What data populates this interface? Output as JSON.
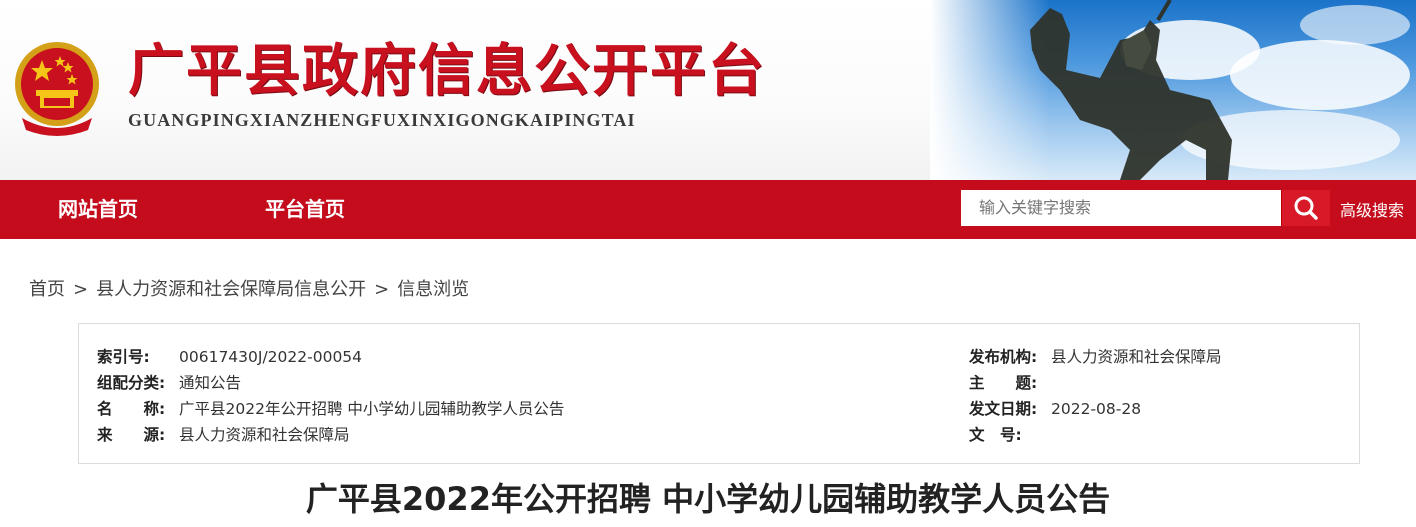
{
  "header": {
    "title": "广平县政府信息公开平台",
    "subtitle": "GUANGPINGXIANZHENGFUXINXIGONGKAIPINGTAI"
  },
  "nav": {
    "home_label": "网站首页",
    "platform_label": "平台首页",
    "search_placeholder": "输入关键字搜索",
    "advanced_search_label": "高级搜索"
  },
  "breadcrumb": {
    "items": [
      "首页",
      "县人力资源和社会保障局信息公开",
      "信息浏览"
    ],
    "separator": ">"
  },
  "info": {
    "index_label": "索引号:",
    "index_value": "00617430J/2022-00054",
    "category_label": "组配分类:",
    "category_value": "通知公告",
    "name_label": "名　　称:",
    "name_value": "广平县2022年公开招聘 中小学幼儿园辅助教学人员公告",
    "source_label": "来　　源:",
    "source_value": "县人力资源和社会保障局",
    "publisher_label": "发布机构:",
    "publisher_value": "县人力资源和社会保障局",
    "subject_label": "主　　题:",
    "subject_value": "",
    "date_label": "发文日期:",
    "date_value": "2022-08-28",
    "docno_label": "文　号:",
    "docno_value": ""
  },
  "article": {
    "title": "广平县2022年公开招聘 中小学幼儿园辅助教学人员公告"
  },
  "colors": {
    "brand_red": "#c40c1c",
    "title_red": "#c8101e"
  },
  "icons": {
    "search": "search-icon",
    "emblem": "national-emblem-icon",
    "statue": "equestrian-statue-image"
  }
}
